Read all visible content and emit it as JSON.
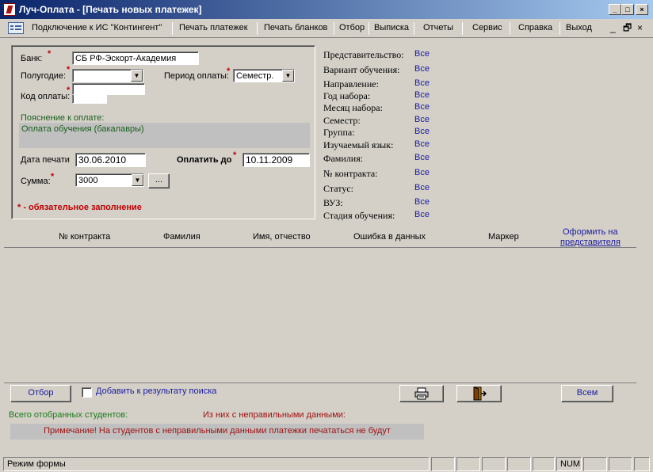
{
  "window": {
    "title": "Луч-Оплата - [Печать новых платежек]",
    "min_glyph": "_",
    "max_glyph": "□",
    "close_glyph": "×"
  },
  "menu": {
    "items": [
      "Подключение к ИС \"Контингент\"",
      "Печать платежек",
      "Печать бланков",
      "Отбор",
      "Выписка",
      "Отчеты",
      "Сервис",
      "Справка",
      "Выход"
    ],
    "mdi_min": "_",
    "mdi_restore": "🗗",
    "mdi_close": "×"
  },
  "form": {
    "bank_label": "Банк:",
    "bank_value": "СБ РФ-Эскорт-Академия",
    "halfyear_label": "Полугодие:",
    "halfyear_value": "",
    "period_label": "Период оплаты:",
    "period_value": "Семестр.",
    "code_label": "Код оплаты:",
    "code_value": "",
    "explanation_label": "Пояснение к оплате:",
    "explanation_value": "Оплата обучения (бакалавры)",
    "print_date_label": "Дата печати",
    "print_date_value": "30.06.2010",
    "pay_until_label": "Оплатить до",
    "pay_until_value": "10.11.2009",
    "sum_label": "Сумма:",
    "sum_value": "3000",
    "ellipsis_button": "...",
    "required_star": "*",
    "required_note": "* - обязательное заполнение"
  },
  "filters": [
    {
      "label": "Представительство:",
      "value": "Все"
    },
    {
      "label": "Вариант обучения:",
      "value": "Все"
    },
    {
      "label": "Направление:",
      "value": "Все"
    },
    {
      "label": "Год набора:",
      "value": "Все"
    },
    {
      "label": "Месяц набора:",
      "value": "Все"
    },
    {
      "label": "Семестр:",
      "value": "Все"
    },
    {
      "label": "Группа:",
      "value": "Все"
    },
    {
      "label": "Изучаемый язык:",
      "value": "Все"
    },
    {
      "label": "Фамилия:",
      "value": "Все"
    },
    {
      "label": "№ контракта:",
      "value": "Все"
    },
    {
      "label": "Статус:",
      "value": "Все"
    },
    {
      "label": "ВУЗ:",
      "value": "Все"
    },
    {
      "label": "Стадия обучения:",
      "value": "Все"
    }
  ],
  "table": {
    "headers": [
      "№ контракта",
      "Фамилия",
      "Имя, отчество",
      "Ошибка в данных",
      "Маркер"
    ],
    "link_header_line1": "Оформить на",
    "link_header_line2": "представителя"
  },
  "bottom": {
    "select_button": "Отбор",
    "add_to_results_label": "Добавить к результату поиска",
    "all_button": "Всем",
    "total_label": "Всего отобранных студентов:",
    "invalid_label": "Из них с неправильными данными:",
    "note": "Примечание! На студентов с неправильными данными платежки печататься не будут"
  },
  "status": {
    "mode": "Режим формы",
    "num": "NUM"
  }
}
